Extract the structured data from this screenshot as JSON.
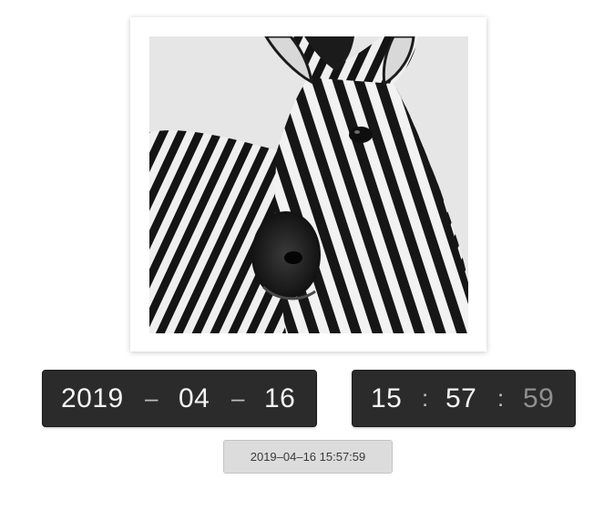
{
  "photo": {
    "subject": "zebra portrait, black and white"
  },
  "date": {
    "year": "2019",
    "month": "04",
    "day": "16",
    "separator": "–"
  },
  "time": {
    "hours": "15",
    "minutes": "57",
    "seconds": "59",
    "separator": ":"
  },
  "timestamp_button": {
    "label": "2019–04–16 15:57:59"
  },
  "colors": {
    "panel_bg": "#2b2b2b",
    "digit": "#f5f5f5",
    "seconds_digit": "#8f8f8f",
    "button_bg": "#dcdcdc"
  }
}
